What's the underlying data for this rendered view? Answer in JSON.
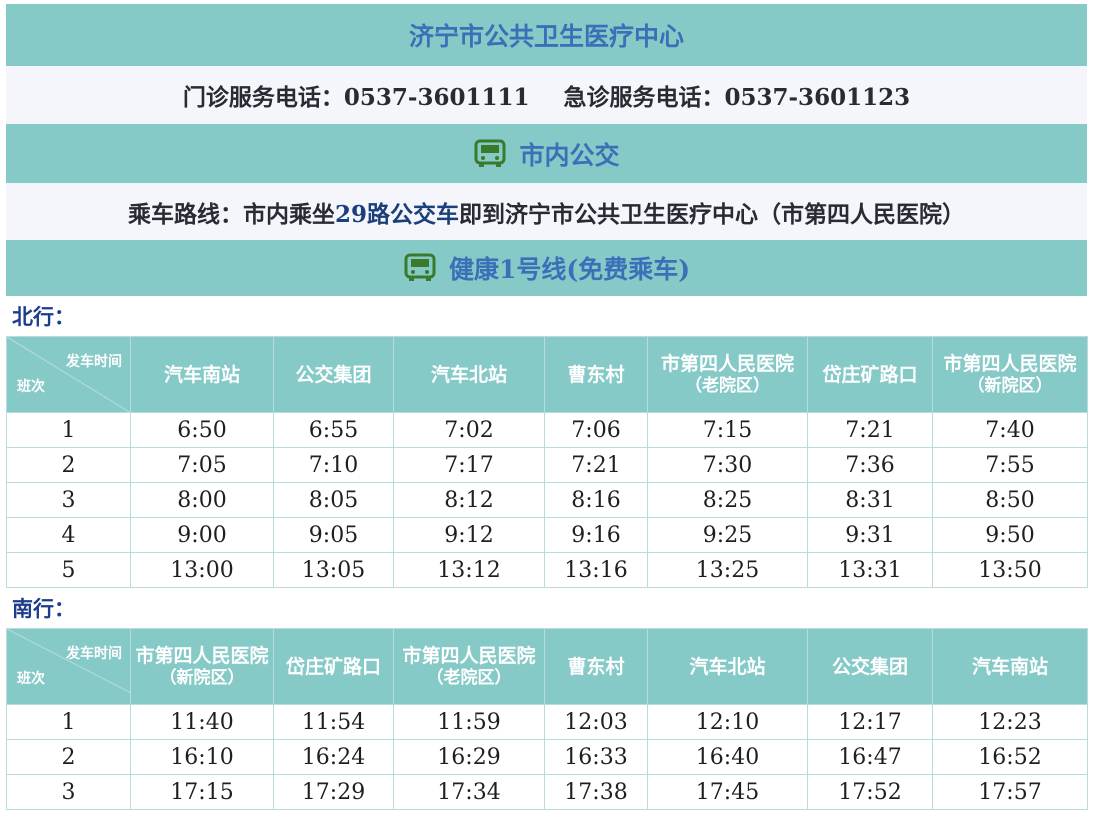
{
  "header": {
    "title": "济宁市公共卫生医疗中心",
    "phones": {
      "outpatient": "门诊服务电话：0537-3601111",
      "emergency": "急诊服务电话：0537-3601123"
    }
  },
  "city_bus": {
    "heading": "市内公交",
    "icon": "bus-icon",
    "route_prefix": "乘车路线：市内乘坐",
    "route_highlight": "29路公交车",
    "route_suffix": "即到济宁市公共卫生医疗中心（市第四人民医院）"
  },
  "health_line": {
    "heading": "健康1号线(免费乘车)",
    "icon": "bus-icon"
  },
  "colors": {
    "band": "#86cac8",
    "heading_text": "#3b6fb8",
    "direction_text": "#1c3d8c"
  },
  "northbound": {
    "label": "北行：",
    "corner_top": "发车时间",
    "corner_bottom": "班次",
    "stops": [
      {
        "name": "汽车南站",
        "sub": ""
      },
      {
        "name": "公交集团",
        "sub": ""
      },
      {
        "name": "汽车北站",
        "sub": ""
      },
      {
        "name": "曹东村",
        "sub": ""
      },
      {
        "name": "市第四人民医院",
        "sub": "（老院区）"
      },
      {
        "name": "岱庄矿路口",
        "sub": ""
      },
      {
        "name": "市第四人民医院",
        "sub": "（新院区）"
      }
    ],
    "rows": [
      [
        "1",
        "6:50",
        "6:55",
        "7:02",
        "7:06",
        "7:15",
        "7:21",
        "7:40"
      ],
      [
        "2",
        "7:05",
        "7:10",
        "7:17",
        "7:21",
        "7:30",
        "7:36",
        "7:55"
      ],
      [
        "3",
        "8:00",
        "8:05",
        "8:12",
        "8:16",
        "8:25",
        "8:31",
        "8:50"
      ],
      [
        "4",
        "9:00",
        "9:05",
        "9:12",
        "9:16",
        "9:25",
        "9:31",
        "9:50"
      ],
      [
        "5",
        "13:00",
        "13:05",
        "13:12",
        "13:16",
        "13:25",
        "13:31",
        "13:50"
      ]
    ]
  },
  "southbound": {
    "label": "南行：",
    "corner_top": "发车时间",
    "corner_bottom": "班次",
    "stops": [
      {
        "name": "市第四人民医院",
        "sub": "（新院区）"
      },
      {
        "name": "岱庄矿路口",
        "sub": ""
      },
      {
        "name": "市第四人民医院",
        "sub": "（老院区）"
      },
      {
        "name": "曹东村",
        "sub": ""
      },
      {
        "name": "汽车北站",
        "sub": ""
      },
      {
        "name": "公交集团",
        "sub": ""
      },
      {
        "name": "汽车南站",
        "sub": ""
      }
    ],
    "rows": [
      [
        "1",
        "11:40",
        "11:54",
        "11:59",
        "12:03",
        "12:10",
        "12:17",
        "12:23"
      ],
      [
        "2",
        "16:10",
        "16:24",
        "16:29",
        "16:33",
        "16:40",
        "16:47",
        "16:52"
      ],
      [
        "3",
        "17:15",
        "17:29",
        "17:34",
        "17:38",
        "17:45",
        "17:52",
        "17:57"
      ]
    ]
  }
}
